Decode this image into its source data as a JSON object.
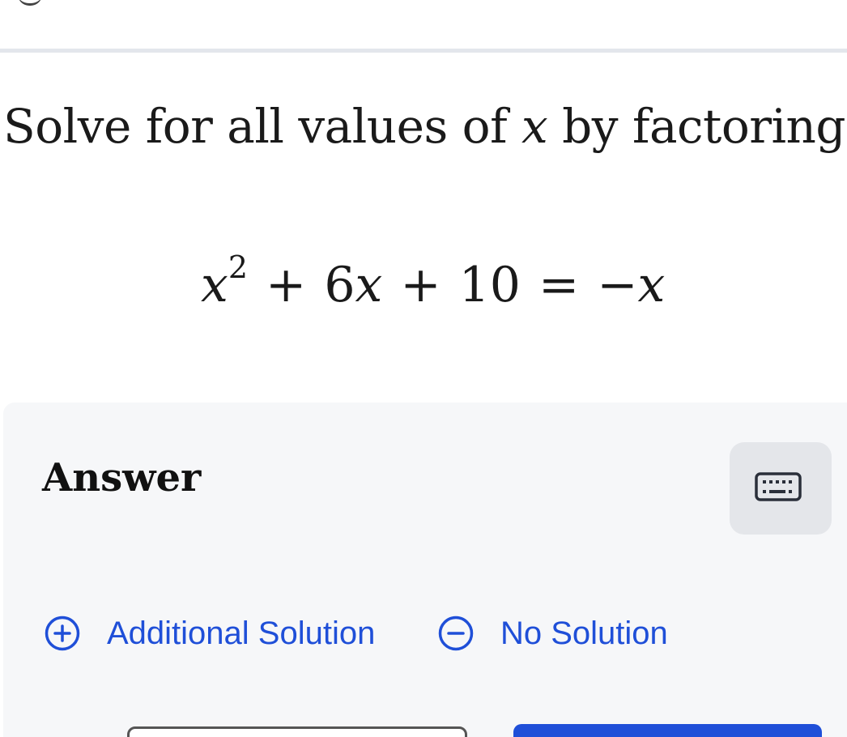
{
  "question": {
    "prefix": "Solve for all values of ",
    "variable": "x",
    "suffix": " by factoring."
  },
  "equation": {
    "term1_var": "x",
    "term1_exp": "2",
    "op1": "+",
    "term2_coef": "6",
    "term2_var": "x",
    "op2": "+",
    "term3": "10",
    "eq": "=",
    "rhs_sign": "−",
    "rhs_var": "x"
  },
  "answer": {
    "title": "Answer",
    "keyboard_icon": "keyboard-icon",
    "options": {
      "additional_solution": "Additional Solution",
      "no_solution": "No Solution"
    }
  },
  "colors": {
    "accent": "#1f4fd8",
    "panel_bg": "#f6f7f9",
    "divider": "#e3e6ec"
  }
}
